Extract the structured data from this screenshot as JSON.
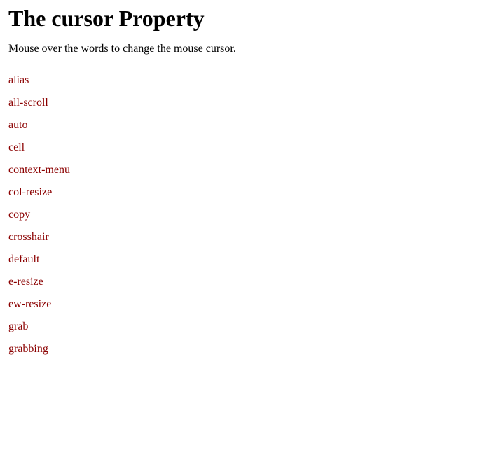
{
  "page": {
    "title": "The cursor Property",
    "subtitle": "Mouse over the words to change the mouse cursor.",
    "cursor_items": [
      {
        "label": "alias",
        "cursor_class": "cursor-alias"
      },
      {
        "label": "all-scroll",
        "cursor_class": "cursor-all-scroll"
      },
      {
        "label": "auto",
        "cursor_class": "cursor-auto"
      },
      {
        "label": "cell",
        "cursor_class": "cursor-cell"
      },
      {
        "label": "context-menu",
        "cursor_class": "cursor-context-menu"
      },
      {
        "label": "col-resize",
        "cursor_class": "cursor-col-resize"
      },
      {
        "label": "copy",
        "cursor_class": "cursor-copy"
      },
      {
        "label": "crosshair",
        "cursor_class": "cursor-crosshair"
      },
      {
        "label": "default",
        "cursor_class": "cursor-default"
      },
      {
        "label": "e-resize",
        "cursor_class": "cursor-e-resize"
      },
      {
        "label": "ew-resize",
        "cursor_class": "cursor-ew-resize"
      },
      {
        "label": "grab",
        "cursor_class": "cursor-grab"
      },
      {
        "label": "grabbing",
        "cursor_class": "cursor-grabbing"
      }
    ]
  }
}
